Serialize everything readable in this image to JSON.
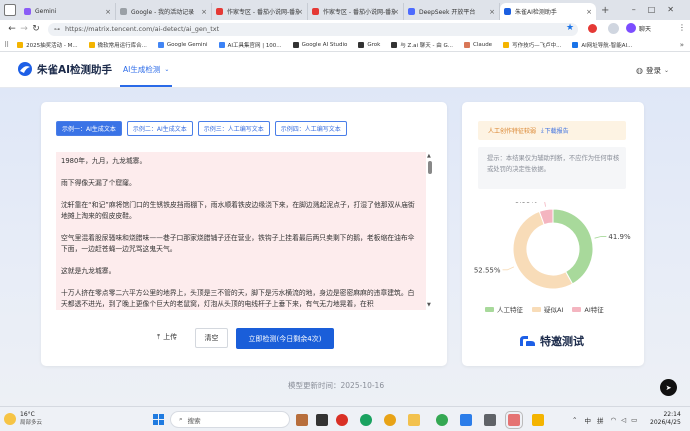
{
  "browser": {
    "tabs": [
      {
        "title": "Gemini",
        "color": "#8a5cf6"
      },
      {
        "title": "Google - 我的活动记录",
        "color": "#9aa0a6"
      },
      {
        "title": "作家专区 - 番茄小说网-番茄",
        "color": "#e53935"
      },
      {
        "title": "作家专区 - 番茄小说网-番茄",
        "color": "#e53935"
      },
      {
        "title": "DeepSeek 开放平台",
        "color": "#4d6bfe"
      },
      {
        "title": "朱雀AI检测助手",
        "color": "#1c5fe0"
      }
    ],
    "url": "https://matrix.tencent.com/ai-detect/ai_gen_txt",
    "user_label": "聊天",
    "bookmarks": [
      {
        "label": "2025抽奖活动 - M...",
        "color": "#f4b400"
      },
      {
        "label": "微软常用运行库合...",
        "color": "#f4b400"
      },
      {
        "label": "Google Gemini",
        "color": "#4285f4"
      },
      {
        "label": "AI工具集官网 | 100...",
        "color": "#3b82f6"
      },
      {
        "label": "Google AI Studio",
        "color": "#333333"
      },
      {
        "label": "Grok",
        "color": "#333333"
      },
      {
        "label": "与 Z.ai 聊天 - 由 G...",
        "color": "#333333"
      },
      {
        "label": "Claude",
        "color": "#d97757"
      },
      {
        "label": "写作技巧—飞卢中...",
        "color": "#f4b400"
      },
      {
        "label": "AI网址导航-智能AI...",
        "color": "#1a73e8"
      }
    ]
  },
  "app": {
    "brand": "朱雀AI检测助手",
    "nav_tab": "AI生成检测",
    "login": "登录"
  },
  "examples": [
    "示例一：AI生成文本",
    "示例二：AI生成文本",
    "示例三：人工编写文本",
    "示例四：人工编写文本"
  ],
  "text_content": [
    "1980年，九月，九龙城寨。",
    "雨下得像天漏了个窟窿。",
    "沈轩靠在“和记”麻将馆门口的生锈铁皮挡雨棚下，雨水顺着铁皮边缘浇下来，在脚边溅起泥点子，打湿了他那双从庙街地摊上淘来的假皮皮鞋。",
    "空气里混着股尿骚味和烧腊味——巷子口那家烧腊铺子还在营业，铁钩子上挂着最后两只卖剩下的鹅，老板缩在油布伞下面，一边赶苍蝇一边咒骂这鬼天气。",
    "这就是九龙城寨。",
    "十万人挤在零点零二六平方公里的地界上，头顶是三不管的天，脚下是污水横流的地，身边是密密麻麻的违章建筑。白天都透不进光，到了晚上更像个巨大的老鼠窝，灯泡从头顶的电线杆子上垂下来，有气无力地晃着，在积"
  ],
  "actions": {
    "upload": "上传",
    "clear": "清空",
    "detect": "立即检测(今日剩余4次)"
  },
  "footer": {
    "model_update": "模型更新时间：2025-10-16"
  },
  "result": {
    "grade_label": "人工创作特征较弱",
    "download": "下载报告",
    "notice": "提示：本结果仅为辅助判断，不应作为任何审核或处罚的决定性依据。",
    "legend": [
      "人工特征",
      "疑似AI",
      "AI特征"
    ],
    "brand_test": "特邀测试"
  },
  "chart_data": {
    "type": "pie",
    "categories": [
      "人工特征",
      "疑似AI",
      "AI特征"
    ],
    "values": [
      41.9,
      52.55,
      5.55
    ],
    "value_labels": [
      "41.9%",
      "52.55%",
      "5.55%"
    ],
    "colors": [
      "#a8d99b",
      "#f8dcb8",
      "#f4b5c0"
    ],
    "legend_placement": "bottom"
  },
  "taskbar": {
    "weather_temp": "16°C",
    "weather_desc": "局部多云",
    "search_placeholder": "搜索",
    "lang_1": "中",
    "lang_2": "拼",
    "time": "22:14",
    "date": "2026/4/25"
  }
}
